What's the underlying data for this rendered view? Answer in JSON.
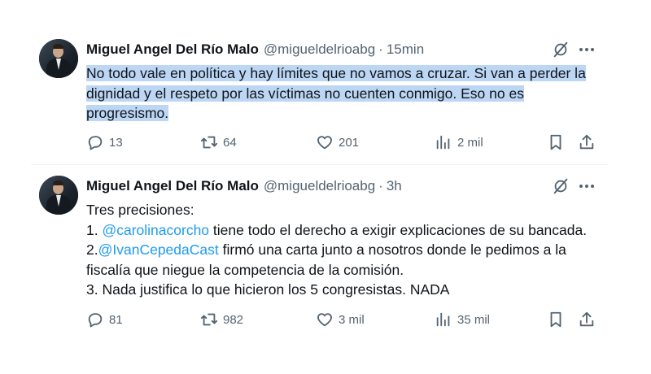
{
  "tweets": [
    {
      "author_name": "Miguel Angel Del Río Malo",
      "handle": "@migueldelrioabg",
      "separator": "·",
      "time": "15min",
      "text": "No todo vale en política y hay límites que no vamos a cruzar. Si van a perder la dignidad y el respeto por las víctimas no cuenten conmigo. Eso no es progresismo.",
      "text_selected": true,
      "replies": "13",
      "retweets": "64",
      "likes": "201",
      "views": "2 mil"
    },
    {
      "author_name": "Miguel Angel Del Río Malo",
      "handle": "@migueldelrioabg",
      "separator": "·",
      "time": "3h",
      "text_line1": "Tres precisiones:",
      "text_part2_prefix": " 1. ",
      "mention1": "@carolinacorcho",
      "text_part2_suffix": " tiene todo el derecho a exigir explicaciones de su bancada. 2.",
      "mention2": "@IvanCepedaCast",
      "text_part3": " firmó una carta junto a nosotros donde le pedimos a la fiscalía que niegue la competencia de la comisión.",
      "text_line4": "3. Nada justifica lo que hicieron los 5 congresistas. NADA",
      "replies": "81",
      "retweets": "982",
      "likes": "3 mil",
      "views": "35 mil"
    }
  ],
  "colors": {
    "text": "#0f1419",
    "secondary": "#536471",
    "link": "#1d9bf0",
    "selection": "#bcd6f4"
  },
  "icons": [
    "grok-icon",
    "more-icon",
    "reply-icon",
    "retweet-icon",
    "like-icon",
    "views-icon",
    "bookmark-icon",
    "share-icon"
  ]
}
